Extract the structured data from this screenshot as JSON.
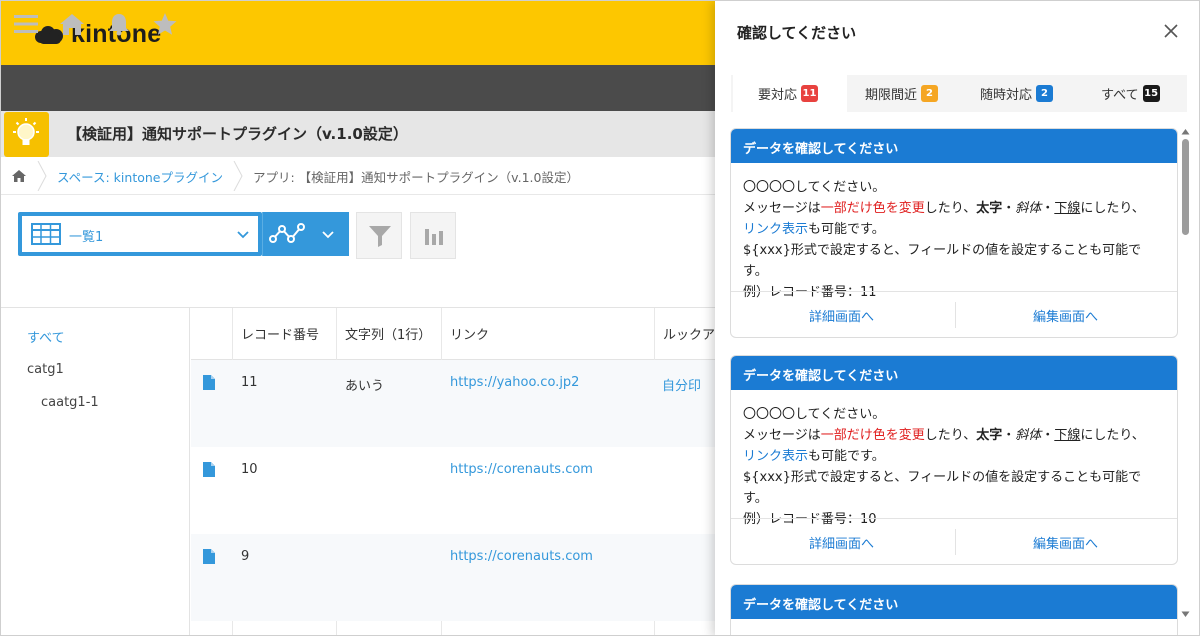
{
  "brand": {
    "name": "kintone"
  },
  "nav": {
    "icons": [
      "menu-icon",
      "home-icon",
      "bell-icon",
      "star-icon"
    ]
  },
  "app": {
    "title": "【検証用】通知サポートプラグイン（v.1.0設定）"
  },
  "breadcrumb": {
    "space": "スペース: kintoneプラグイン",
    "app": "アプリ: 【検証用】通知サポートプラグイン（v.1.0設定）"
  },
  "view": {
    "selected": "一覧1"
  },
  "sidebar": {
    "items": [
      "すべて",
      "catg1",
      "caatg1-1"
    ]
  },
  "table": {
    "headers": [
      "レコード番号",
      "文字列（1行）",
      "リンク",
      "ルックア"
    ],
    "rows": [
      {
        "id": "11",
        "text": "あいう",
        "link": "https://yahoo.co.jp2",
        "lookup": "自分印"
      },
      {
        "id": "10",
        "text": "",
        "link": "https://corenauts.com",
        "lookup": ""
      },
      {
        "id": "9",
        "text": "",
        "link": "https://corenauts.com",
        "lookup": ""
      }
    ]
  },
  "dialog": {
    "title": "確認してください",
    "tabs": [
      {
        "label": "要対応",
        "count": "11",
        "color": "#e8423f"
      },
      {
        "label": "期限間近",
        "count": "2",
        "color": "#f5a623"
      },
      {
        "label": "随時対応",
        "count": "2",
        "color": "#1b7bd3"
      },
      {
        "label": "すべて",
        "count": "15",
        "color": "#1a1a1a"
      }
    ],
    "cards": [
      {
        "header": "データを確認してください",
        "line1": "〇〇〇〇してください。",
        "msg_a": "メッセージは",
        "msg_red": "一部だけ色を変更",
        "msg_b": "したり、",
        "msg_bold": "太字",
        "msg_dot1": "・",
        "msg_italic": "斜体",
        "msg_dot2": "・",
        "msg_under": "下線",
        "msg_c": "にしたり、",
        "link_text": "リンク表示",
        "link_after": "も可能です。",
        "line4": "${xxx}形式で設定すると、フィールドの値を設定することも可能です。",
        "line5": "例）レコード番号：11",
        "detail": "詳細画面へ",
        "edit": "編集画面へ"
      },
      {
        "header": "データを確認してください",
        "line1": "〇〇〇〇してください。",
        "msg_a": "メッセージは",
        "msg_red": "一部だけ色を変更",
        "msg_b": "したり、",
        "msg_bold": "太字",
        "msg_dot1": "・",
        "msg_italic": "斜体",
        "msg_dot2": "・",
        "msg_under": "下線",
        "msg_c": "にしたり、",
        "link_text": "リンク表示",
        "link_after": "も可能です。",
        "line4": "${xxx}形式で設定すると、フィールドの値を設定することも可能です。",
        "line5": "例）レコード番号：10",
        "detail": "詳細画面へ",
        "edit": "編集画面へ"
      },
      {
        "header": "データを確認してください"
      }
    ]
  },
  "colors": {
    "brand_yellow": "#fdc700",
    "nav_gray": "#4b4b4b",
    "accent_blue": "#3498db",
    "card_blue": "#1b7bd3"
  }
}
